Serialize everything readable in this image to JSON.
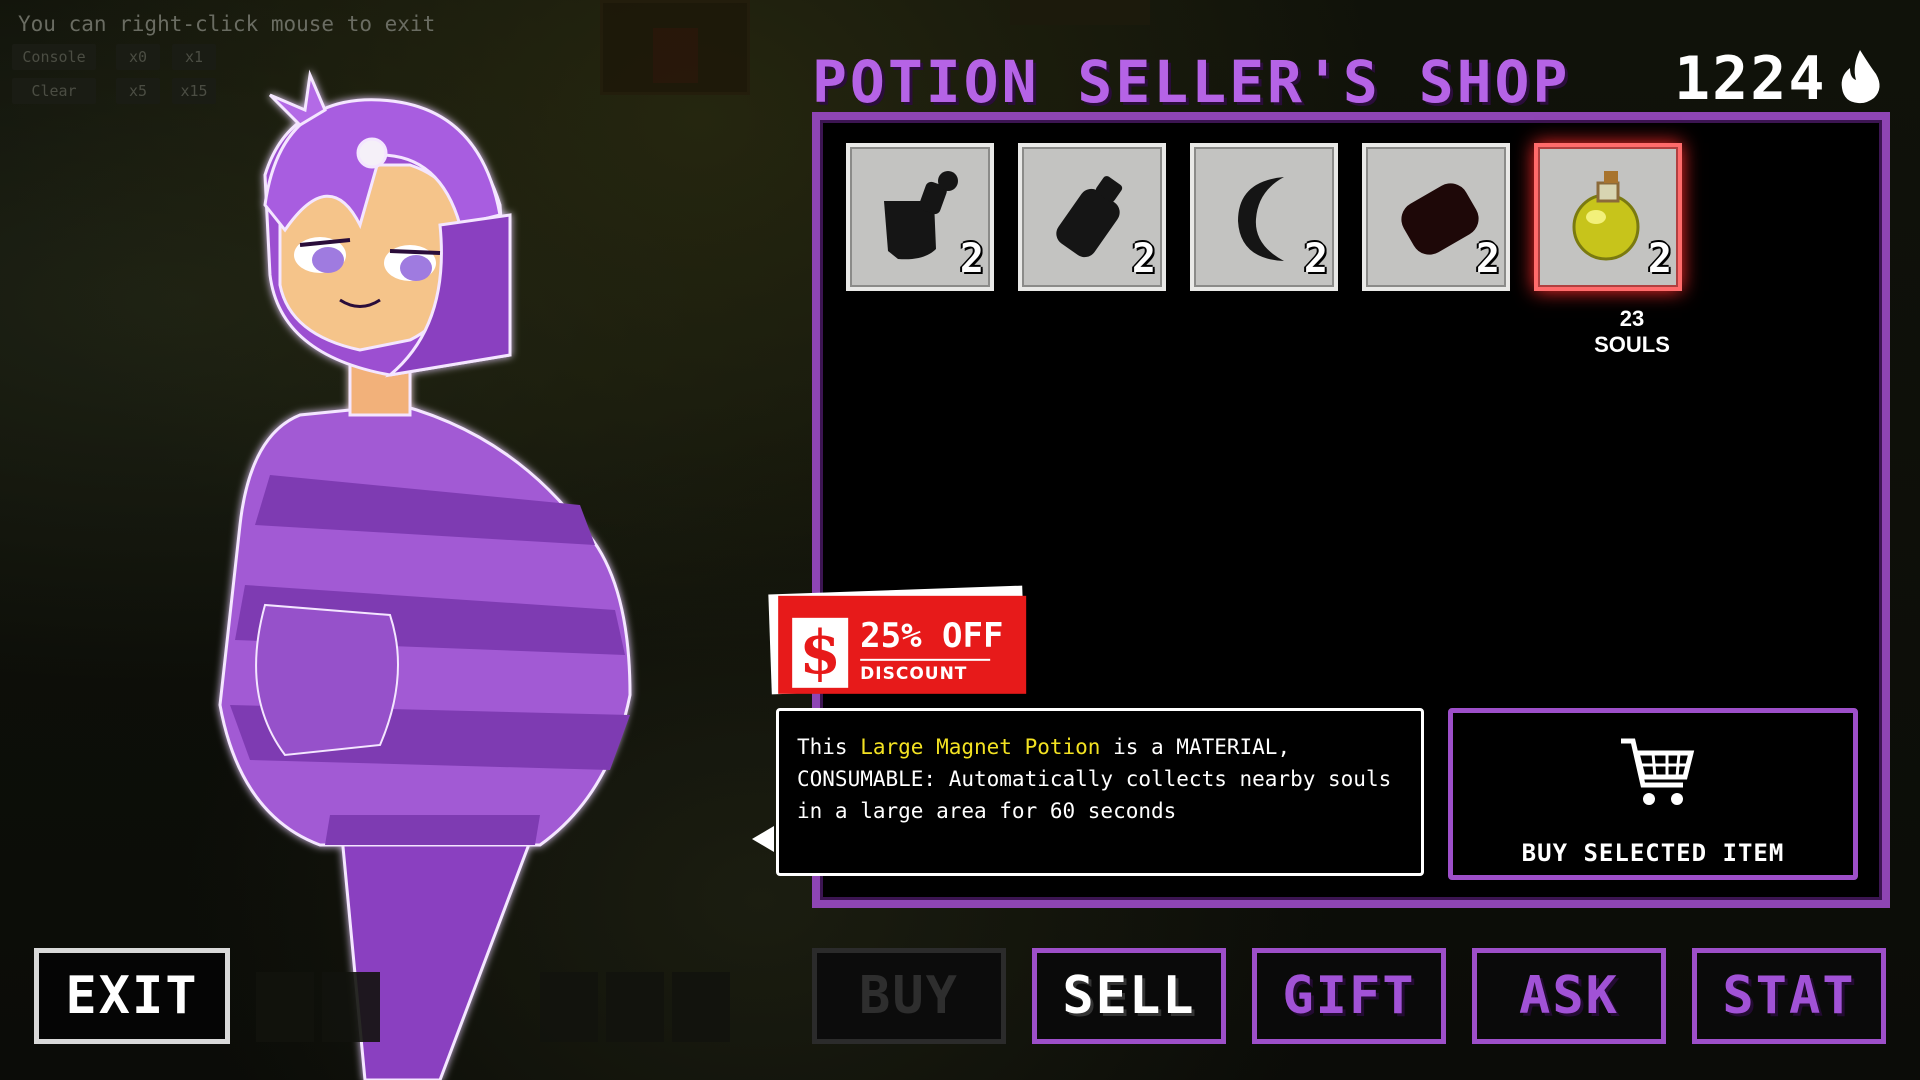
{
  "debug": {
    "hint": "You can right-click mouse to exit",
    "buttons": [
      "Console",
      "x0",
      "x1",
      "Clear",
      "x5",
      "x15"
    ]
  },
  "shop": {
    "title": "POTION SELLER'S SHOP",
    "currency_amount": "1224",
    "currency_icon": "flame-icon"
  },
  "items": [
    {
      "name": "locked-item-1",
      "icon": "silhouette-pot",
      "qty": "2",
      "selected": false
    },
    {
      "name": "locked-item-2",
      "icon": "silhouette-bottle",
      "qty": "2",
      "selected": false
    },
    {
      "name": "locked-item-3",
      "icon": "silhouette-moon",
      "qty": "2",
      "selected": false
    },
    {
      "name": "locked-item-4",
      "icon": "silhouette-stone",
      "qty": "2",
      "selected": false
    },
    {
      "name": "large-magnet-potion",
      "icon": "potion-icon",
      "qty": "2",
      "selected": true
    }
  ],
  "selected_price": "23 SOULS",
  "discount": {
    "symbol": "$",
    "amount": "25% OFF",
    "label": "DISCOUNT",
    "color": "#e71a1a"
  },
  "description": {
    "prefix": "This ",
    "item_name": "Large Magnet Potion",
    "suffix": " is a MATERIAL, CONSUMABLE: Automatically collects nearby souls in a large area for 60 seconds",
    "highlight_color": "#f3e222"
  },
  "buy_button": {
    "label": "BUY SELECTED ITEM",
    "icon": "cart-icon"
  },
  "tabs": [
    {
      "label": "BUY",
      "state": "disabled"
    },
    {
      "label": "SELL",
      "state": "active"
    },
    {
      "label": "GIFT",
      "state": "normal"
    },
    {
      "label": "ASK",
      "state": "normal"
    },
    {
      "label": "STAT",
      "state": "normal"
    }
  ],
  "exit_label": "EXIT",
  "colors": {
    "accent_purple": "#9d4fc9",
    "title_purple": "#b563e6"
  }
}
